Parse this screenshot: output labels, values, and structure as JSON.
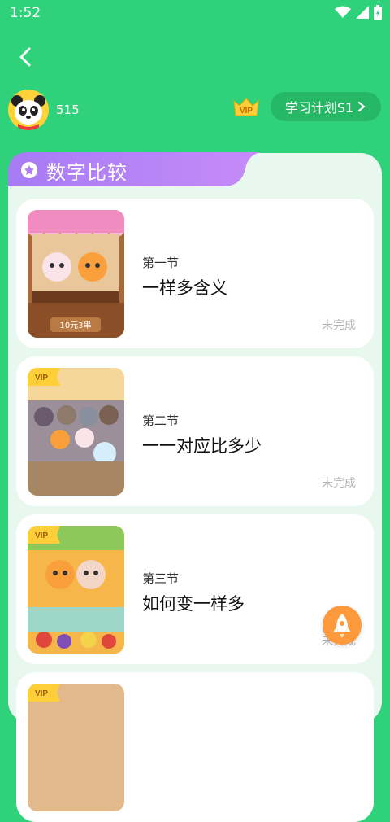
{
  "status_bar": {
    "time": "1:52"
  },
  "header": {
    "score": "515",
    "vip_label": "VIP",
    "plan_button_label": "学习计划S1"
  },
  "panel": {
    "title": "数字比较"
  },
  "lessons": [
    {
      "section": "第一节",
      "title": "一样多含义",
      "status": "未完成",
      "vip": false,
      "sign_text": "10元3串"
    },
    {
      "section": "第二节",
      "title": "一一对应比多少",
      "status": "未完成",
      "vip": true,
      "vip_label": "VIP"
    },
    {
      "section": "第三节",
      "title": "如何变一样多",
      "status": "未完成",
      "vip": true,
      "vip_label": "VIP"
    },
    {
      "vip": true,
      "vip_label": "VIP"
    }
  ],
  "colors": {
    "background": "#2fd17b",
    "panel": "#e8f8ef",
    "tab_purple": "#b07cf7",
    "status_grey": "#b3b3b3",
    "rocket": "#ff9a3c"
  }
}
